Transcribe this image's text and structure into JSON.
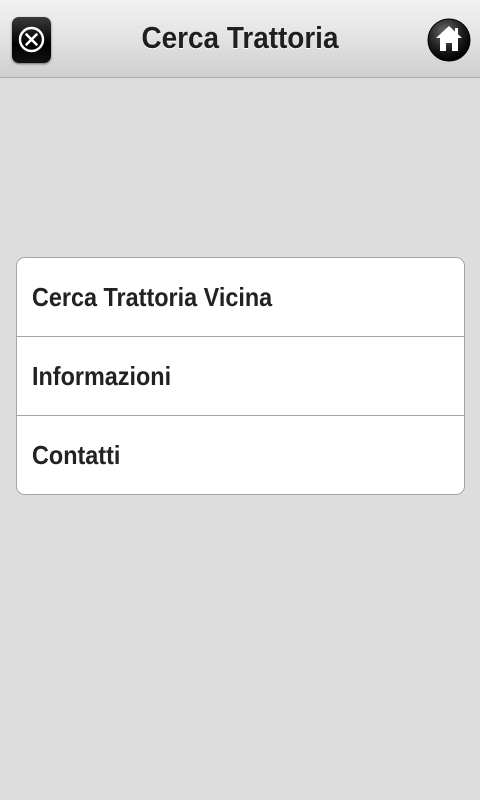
{
  "header": {
    "title": "Cerca Trattoria",
    "close_icon": "close-icon",
    "home_icon": "home-icon"
  },
  "menu": {
    "items": [
      {
        "label": "Cerca Trattoria Vicina"
      },
      {
        "label": "Informazioni"
      },
      {
        "label": "Contatti"
      }
    ]
  },
  "colors": {
    "background": "#dddddd",
    "header_top": "#f2f2f2",
    "header_bottom": "#cfcfcf",
    "text": "#222222"
  }
}
